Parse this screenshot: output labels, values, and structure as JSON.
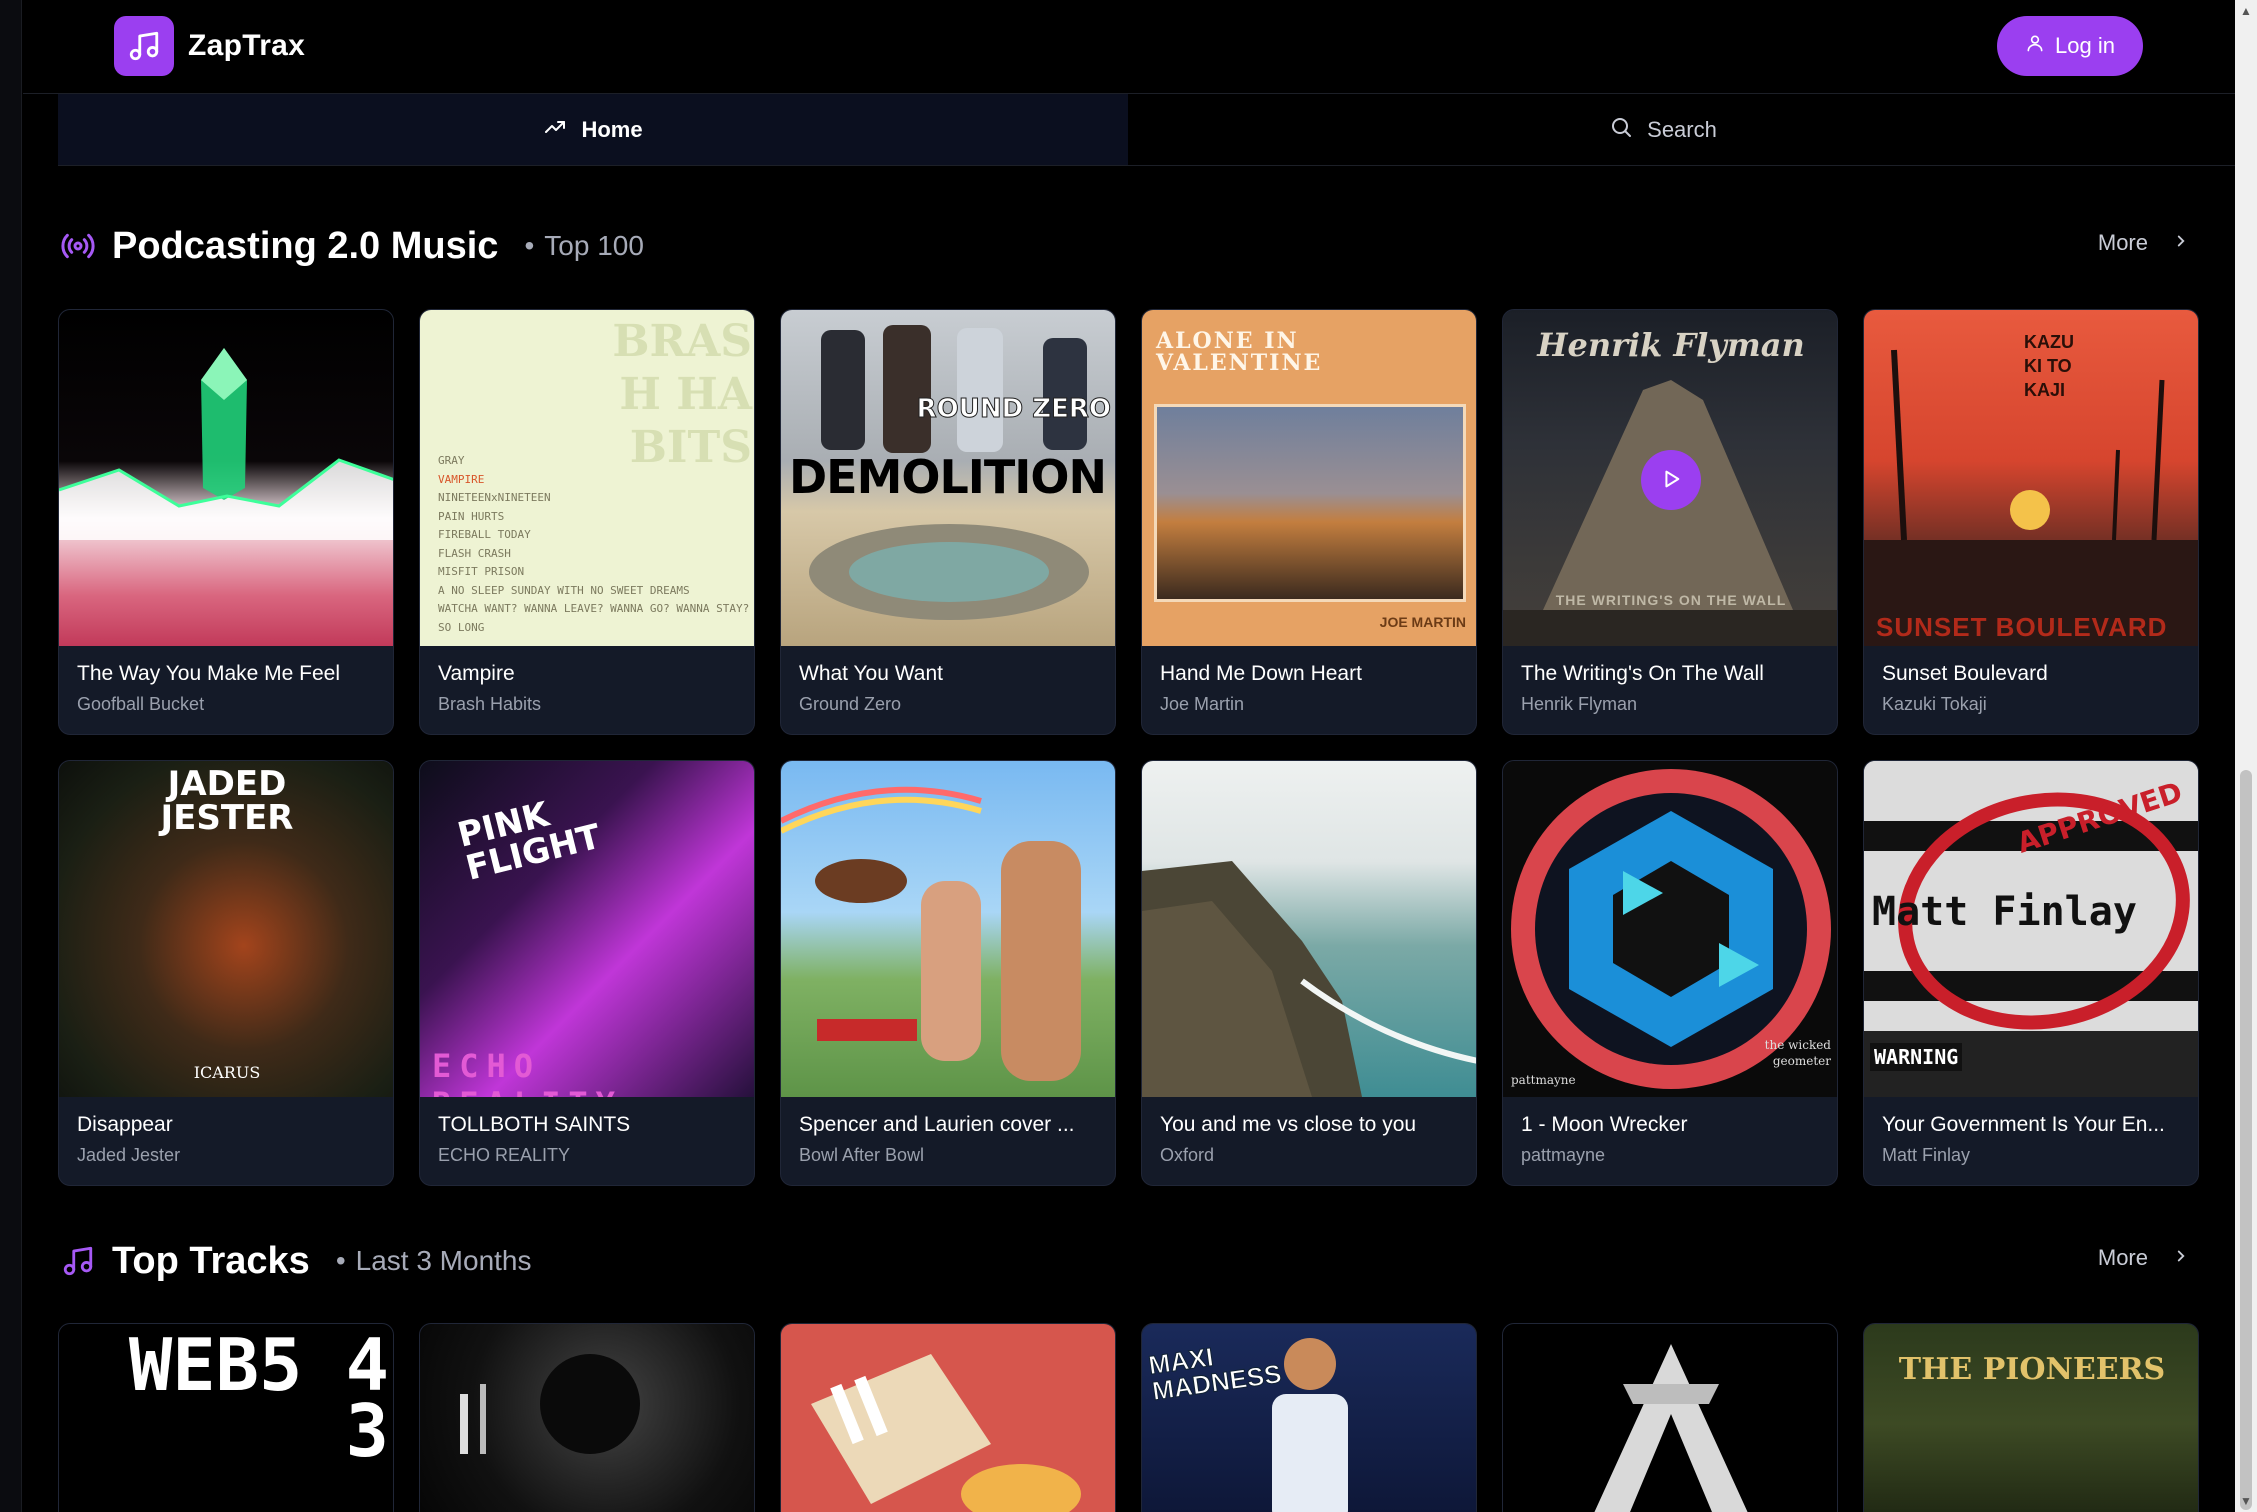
{
  "brand": {
    "name": "ZapTrax",
    "accent": "#9b3ff0"
  },
  "header": {
    "login_label": "Log in"
  },
  "tabs": [
    {
      "label": "Home",
      "icon": "trending-icon",
      "active": true
    },
    {
      "label": "Search",
      "icon": "search-icon",
      "active": false
    }
  ],
  "sections": [
    {
      "title": "Podcasting 2.0 Music",
      "subtitle": "Top 100",
      "icon": "broadcast-icon",
      "more_label": "More",
      "items": [
        {
          "title": "The Way You Make Me Feel",
          "artist": "Goofball Bucket",
          "art": "crystal"
        },
        {
          "title": "Vampire",
          "artist": "Brash Habits",
          "art": "brash",
          "art_text": "BRASH HABITS",
          "tracklist": [
            "GRAY",
            "VAMPIRE",
            "NINETEENxNINETEEN",
            "PAIN HURTS",
            "FIREBALL TODAY",
            "FLASH CRASH",
            "MISFIT PRISON",
            "A NO SLEEP SUNDAY WITH NO SWEET DREAMS",
            "WATCHA WANT? WANNA LEAVE? WANNA GO? WANNA STAY?",
            "SO LONG"
          ]
        },
        {
          "title": "What You Want",
          "artist": "Ground Zero",
          "art": "demolition",
          "art_text": "DEMOLITION",
          "art_text2": "ROUND ZERO"
        },
        {
          "title": "Hand Me Down Heart",
          "artist": "Joe Martin",
          "art": "alone",
          "art_text": "ALONE IN VALENTINE",
          "art_text2": "JOE MARTIN"
        },
        {
          "title": "The Writing's On The Wall",
          "artist": "Henrik Flyman",
          "art": "henrik",
          "art_text": "Henrik Flyman",
          "art_text2": "THE WRITING'S ON THE WALL"
        },
        {
          "title": "Sunset Boulevard",
          "artist": "Kazuki Tokaji",
          "art": "sunset",
          "art_text": "SUNSET BOULEVARD",
          "art_text2": "KAZUKI TOKAJI"
        },
        {
          "title": "Disappear",
          "artist": "Jaded Jester",
          "art": "jester",
          "art_text": "JADED JESTER",
          "art_text2": "ICARUS"
        },
        {
          "title": "TOLLBOTH SAINTS",
          "artist": "ECHO REALITY",
          "art": "echo",
          "art_text": "ECHO REALITY",
          "art_text2": "PINK FLIGHT"
        },
        {
          "title": "Spencer and Laurien cover ...",
          "artist": "Bowl After Bowl",
          "art": "spencer"
        },
        {
          "title": "You and me vs close to you",
          "artist": "Oxford",
          "art": "coast"
        },
        {
          "title": "1 - Moon Wrecker",
          "artist": "pattmayne",
          "art": "moon",
          "art_text": "pattmayne",
          "art_text2": "the wicked geometer"
        },
        {
          "title": "Your Government Is Your En...",
          "artist": "Matt Finlay",
          "art": "gov",
          "art_text": "Matt Finlay",
          "art_text2": "APPROVED",
          "art_text3": "WARNING"
        }
      ]
    },
    {
      "title": "Top Tracks",
      "subtitle": "Last 3 Months",
      "icon": "music-note-icon",
      "more_label": "More",
      "items": [
        {
          "art": "web5",
          "art_text": "WEB5 4 3"
        },
        {
          "art": "silhouette"
        },
        {
          "art": "cigarettes"
        },
        {
          "art": "maxi",
          "art_text": "MAXI MADNESS"
        },
        {
          "art": "monogram"
        },
        {
          "art": "pioneers",
          "art_text": "THE PIONEERS"
        }
      ]
    }
  ]
}
